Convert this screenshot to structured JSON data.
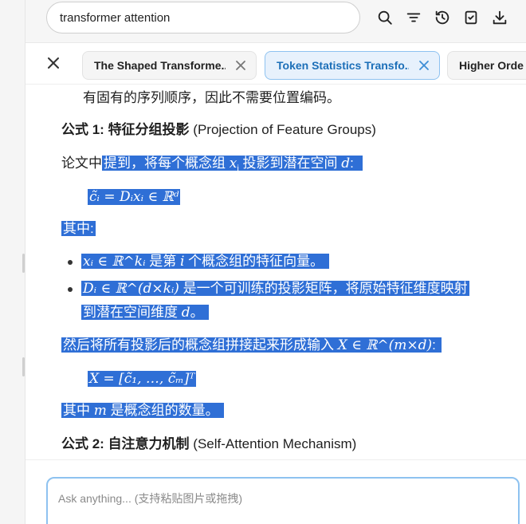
{
  "search": {
    "query": "transformer attention"
  },
  "toolbar": {
    "icons": [
      "search-icon",
      "filter-icon",
      "history-icon",
      "checklist-icon",
      "download-icon"
    ]
  },
  "tabs": [
    {
      "label": "The Shaped Transforme...",
      "active": false
    },
    {
      "label": "Token Statistics Transfo...",
      "active": true
    },
    {
      "label": "Higher Orde",
      "active": false
    }
  ],
  "content": {
    "line0": "有固有的序列顺序，因此不需要位置编码。",
    "formula1_heading": {
      "prefix": "公式 1: ",
      "title": "特征分组投影",
      "suffix": " (Projection of Feature Groups)"
    },
    "para1": {
      "plain": "论文中",
      "hl_a": "提到，将每个概念组 ",
      "var": "x",
      "sub": "i",
      "hl_b": " 投影到潜在空间 ",
      "var2": "d",
      "end": ":"
    },
    "eq1": "c̃ᵢ = Dᵢxᵢ ∈ ℝᵈ",
    "where1": "其中:",
    "bullet1": {
      "math": "xᵢ ∈ ℝ^kᵢ",
      "text": " 是第 ",
      "var": "i",
      "text2": " 个概念组的特征向量。"
    },
    "bullet2": {
      "math": "Dᵢ ∈ ℝ^(d×kᵢ)",
      "text": " 是一个可训练的投影矩阵，将原始特征维度映射",
      "text2": "到潜在空间维度 ",
      "var": "d",
      "end": "。"
    },
    "para2": {
      "text": "然后将所有投影后的概念组拼接起来形成输入 ",
      "var": "X",
      "math": " ∈ ℝ^(m×d)",
      "end": ":"
    },
    "eq2": "X = [c̃₁, …, c̃ₘ]ᵀ",
    "para3": {
      "text": "其中 ",
      "var": "m",
      "text2": " 是概念组的数量。"
    },
    "formula2_heading": {
      "prefix": "公式 2: ",
      "title": "自注意力机制",
      "suffix": " (Self-Attention Mechanism)"
    }
  },
  "input": {
    "placeholder": "Ask anything... (支持粘贴图片或拖拽)"
  }
}
